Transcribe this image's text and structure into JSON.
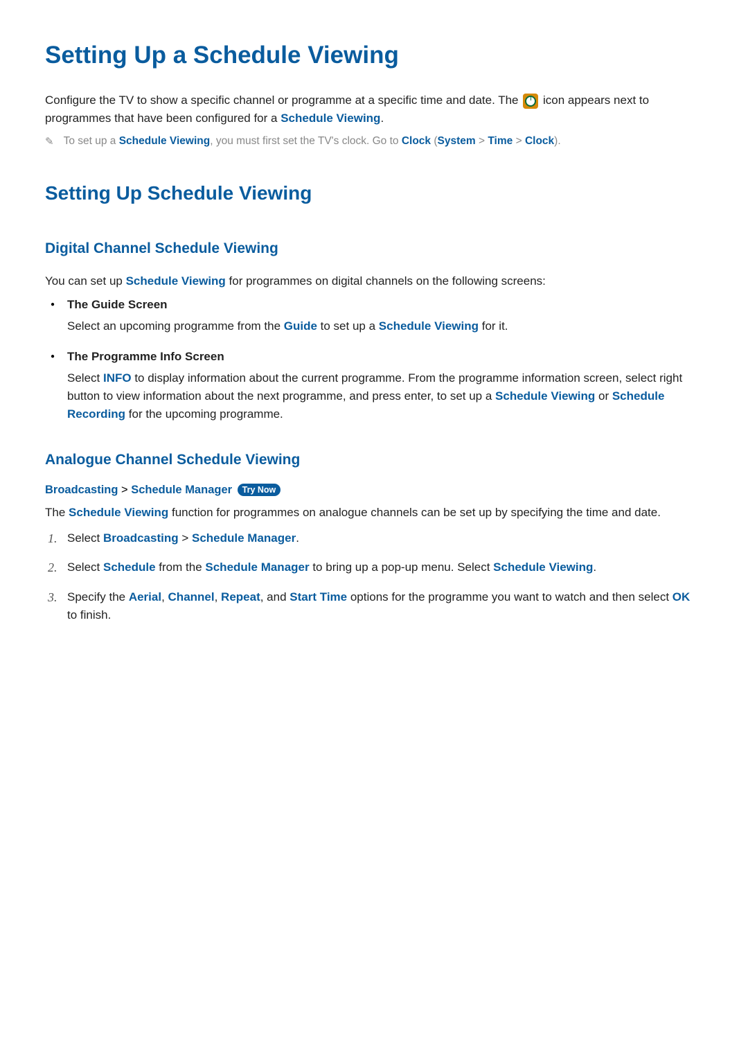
{
  "title": "Setting Up a Schedule Viewing",
  "intro": {
    "part1": "Configure the TV to show a specific channel or programme at a specific time and date. The ",
    "part2": " icon appears next to programmes that have been configured for a ",
    "schedule_viewing": "Schedule Viewing",
    "period": "."
  },
  "note": {
    "prefix": "To set up a ",
    "schedule_viewing": "Schedule Viewing",
    "mid": ", you must first set the TV's clock. Go to ",
    "clock1": "Clock",
    "paren_open": " (",
    "system": "System",
    "sep": " > ",
    "time": "Time",
    "clock2": "Clock",
    "paren_close": ")."
  },
  "h2": "Setting Up Schedule Viewing",
  "digital": {
    "heading": "Digital Channel Schedule Viewing",
    "intro_pre": "You can set up ",
    "intro_sv": "Schedule Viewing",
    "intro_post": " for programmes on digital channels on the following screens:",
    "items": [
      {
        "title": "The Guide Screen",
        "body_pre": "Select an upcoming programme from the ",
        "body_guide": "Guide",
        "body_mid": " to set up a ",
        "body_sv": "Schedule Viewing",
        "body_post": " for it."
      },
      {
        "title": "The Programme Info Screen",
        "body_pre": "Select ",
        "body_info": "INFO",
        "body_mid1": " to display information about the current programme. From the programme information screen, select right button to view information about the next programme, and press enter, to set up a ",
        "body_sv": "Schedule Viewing",
        "body_or": " or ",
        "body_sr": "Schedule Recording",
        "body_post": " for the upcoming programme."
      }
    ]
  },
  "analogue": {
    "heading": "Analogue Channel Schedule Viewing",
    "bc_broadcasting": "Broadcasting",
    "bc_sep": " > ",
    "bc_schedule_manager": "Schedule Manager",
    "try_now": "Try Now",
    "intro_pre": "The ",
    "intro_sv": "Schedule Viewing",
    "intro_post": " function for programmes on analogue channels can be set up by specifying the time and date.",
    "steps": [
      {
        "pre": "Select ",
        "broadcasting": "Broadcasting",
        "sep": " > ",
        "schedule_manager": "Schedule Manager",
        "post": "."
      },
      {
        "pre": "Select ",
        "schedule": "Schedule",
        "mid1": " from the ",
        "schedule_manager": "Schedule Manager",
        "mid2": " to bring up a pop-up menu. Select ",
        "schedule_viewing": "Schedule Viewing",
        "post": "."
      },
      {
        "pre": "Specify the ",
        "aerial": "Aerial",
        "comma1": ", ",
        "channel": "Channel",
        "comma2": ", ",
        "repeat": "Repeat",
        "comma3": ", and ",
        "start_time": "Start Time",
        "mid": " options for the programme you want to watch and then select ",
        "ok": "OK",
        "post": " to finish."
      }
    ]
  }
}
